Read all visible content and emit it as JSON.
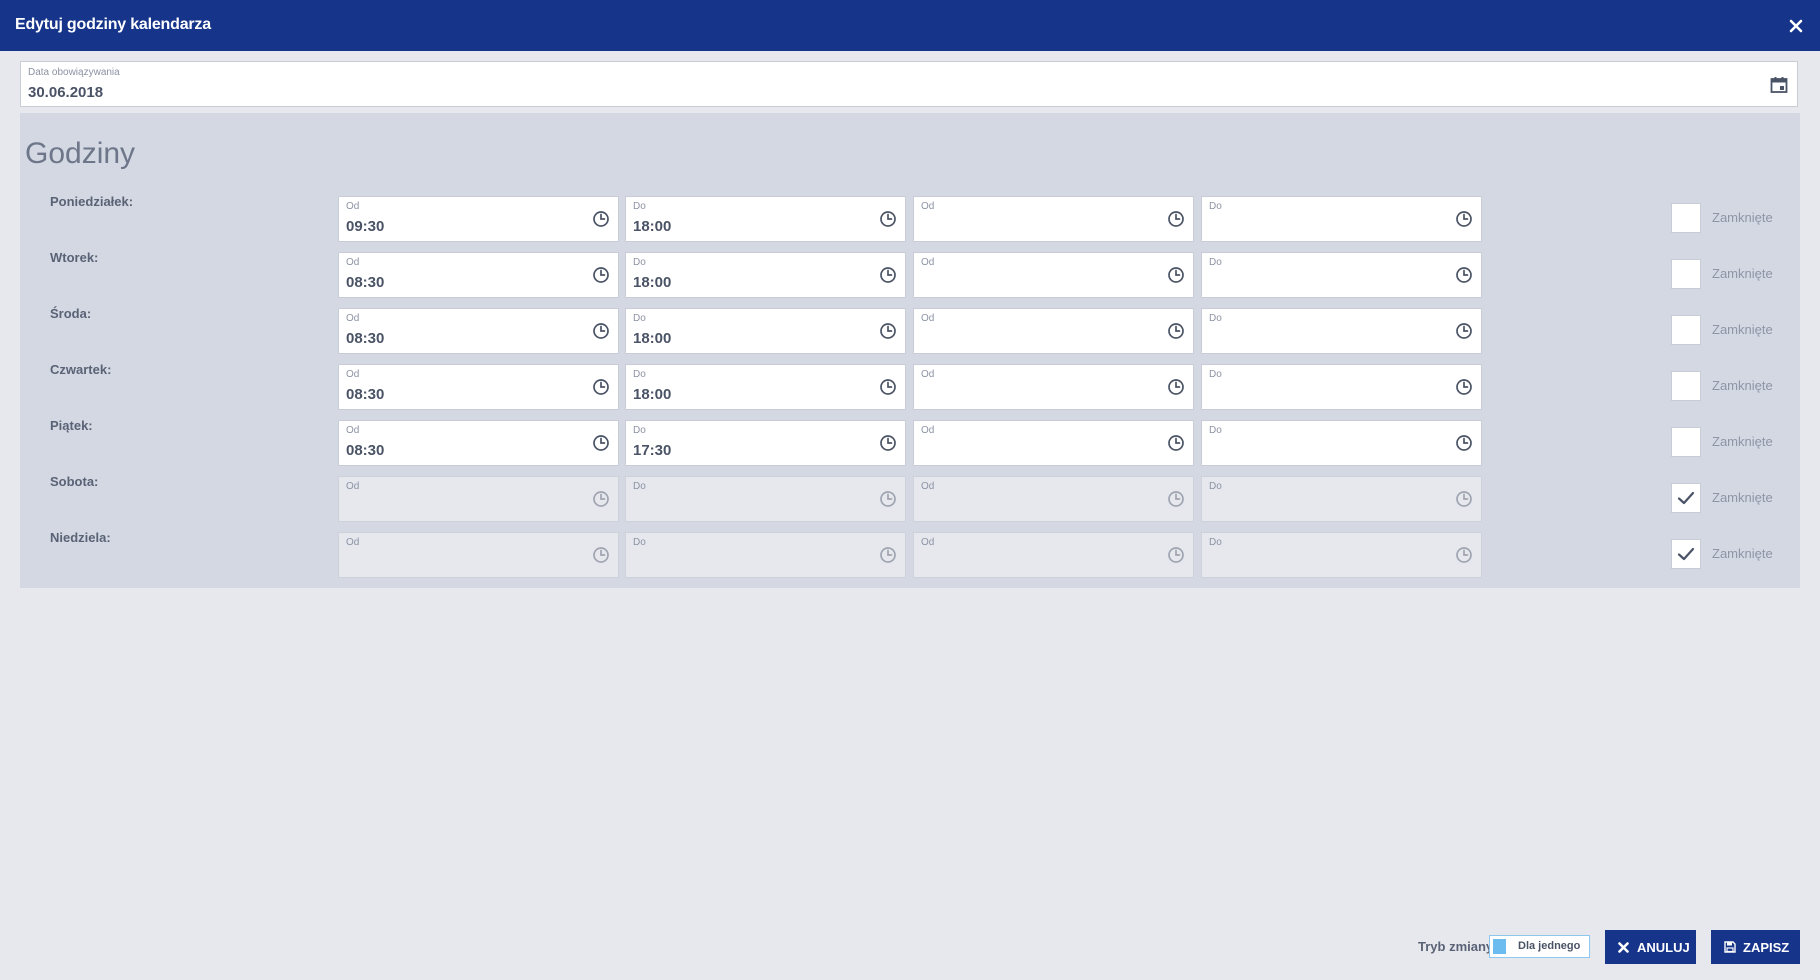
{
  "dialog": {
    "title": "Edytuj godziny kalendarza"
  },
  "date_field": {
    "label": "Data obowiązywania",
    "value": "30.06.2018"
  },
  "hours": {
    "heading": "Godziny",
    "closed_label": "Zamknięte",
    "from_label": "Od",
    "to_label": "Do",
    "days": [
      {
        "name": "Poniedziałek:",
        "from1": "09:30",
        "to1": "18:00",
        "from2": "",
        "to2": "",
        "closed": false
      },
      {
        "name": "Wtorek:",
        "from1": "08:30",
        "to1": "18:00",
        "from2": "",
        "to2": "",
        "closed": false
      },
      {
        "name": "Środa:",
        "from1": "08:30",
        "to1": "18:00",
        "from2": "",
        "to2": "",
        "closed": false
      },
      {
        "name": "Czwartek:",
        "from1": "08:30",
        "to1": "18:00",
        "from2": "",
        "to2": "",
        "closed": false
      },
      {
        "name": "Piątek:",
        "from1": "08:30",
        "to1": "17:30",
        "from2": "",
        "to2": "",
        "closed": false
      },
      {
        "name": "Sobota:",
        "from1": "",
        "to1": "",
        "from2": "",
        "to2": "",
        "closed": true
      },
      {
        "name": "Niedziela:",
        "from1": "",
        "to1": "",
        "from2": "",
        "to2": "",
        "closed": true
      }
    ]
  },
  "footer": {
    "mode_label": "Tryb zmiany",
    "mode_toggle": "Dla jednego",
    "cancel_label": "ANULUJ",
    "save_label": "ZAPISZ"
  },
  "colors": {
    "header_bg": "#15348a",
    "panel_bg": "#d3d8e3",
    "page_bg": "#e6e8ee",
    "toggle_accent": "#6cbcf0"
  },
  "icons": {
    "close": "close-icon",
    "calendar": "calendar-icon",
    "time": "clock-icon",
    "check": "check-icon",
    "cancel": "x-icon",
    "save": "floppy-disk-icon"
  }
}
